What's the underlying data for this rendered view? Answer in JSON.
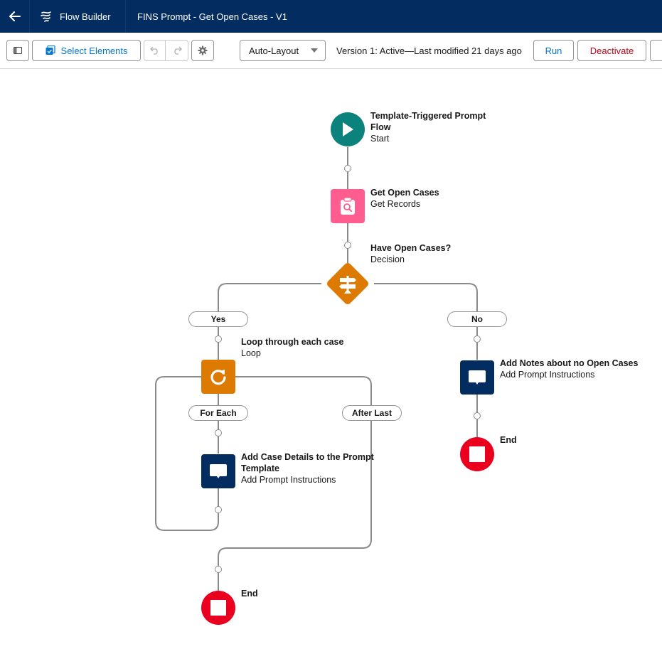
{
  "header": {
    "back_icon": "arrow-left-icon",
    "app_icon": "flow-icon",
    "app_name": "Flow Builder",
    "flow_title": "FINS Prompt - Get Open Cases - V1"
  },
  "toolbar": {
    "toggle_panel_icon": "panel-toggle-icon",
    "select_elements_label": "Select Elements",
    "select_elements_icon": "select-elements-icon",
    "undo_icon": "undo-icon",
    "redo_icon": "redo-icon",
    "settings_icon": "gear-icon",
    "layout_select": "Auto-Layout",
    "status_text": "Version 1: Active—Last modified 21 days ago",
    "run_label": "Run",
    "deactivate_label": "Deactivate"
  },
  "colors": {
    "header_bg": "#032d60",
    "start": "#0b827c",
    "get_records": "#ff5d8f",
    "decision": "#dd7a01",
    "loop": "#dd7a01",
    "prompt_instructions": "#032d60",
    "end": "#ea001e",
    "link": "#0176d3",
    "destructive": "#ba0517"
  },
  "flow": {
    "start": {
      "title_line1": "Template-Triggered Prompt",
      "title_line2": "Flow",
      "subtitle": "Start",
      "icon": "play-icon"
    },
    "get_records": {
      "title": "Get Open Cases",
      "subtitle": "Get Records",
      "icon": "clipboard-search-icon"
    },
    "decision": {
      "title": "Have Open Cases?",
      "subtitle": "Decision",
      "icon": "signpost-icon",
      "outcomes": [
        "Yes",
        "No"
      ]
    },
    "loop": {
      "title": "Loop through each case",
      "subtitle": "Loop",
      "icon": "loop-icon",
      "branches": [
        "For Each",
        "After Last"
      ]
    },
    "add_case_details": {
      "title_line1": "Add Case Details to the Prompt",
      "title_line2": "Template",
      "subtitle": "Add Prompt Instructions",
      "icon": "chat-bubble-icon"
    },
    "add_notes": {
      "title": "Add Notes about no Open Cases",
      "subtitle": "Add Prompt Instructions",
      "icon": "chat-bubble-icon"
    },
    "end_right": {
      "title": "End",
      "icon": "stop-icon"
    },
    "end_bottom": {
      "title": "End",
      "icon": "stop-icon"
    }
  }
}
